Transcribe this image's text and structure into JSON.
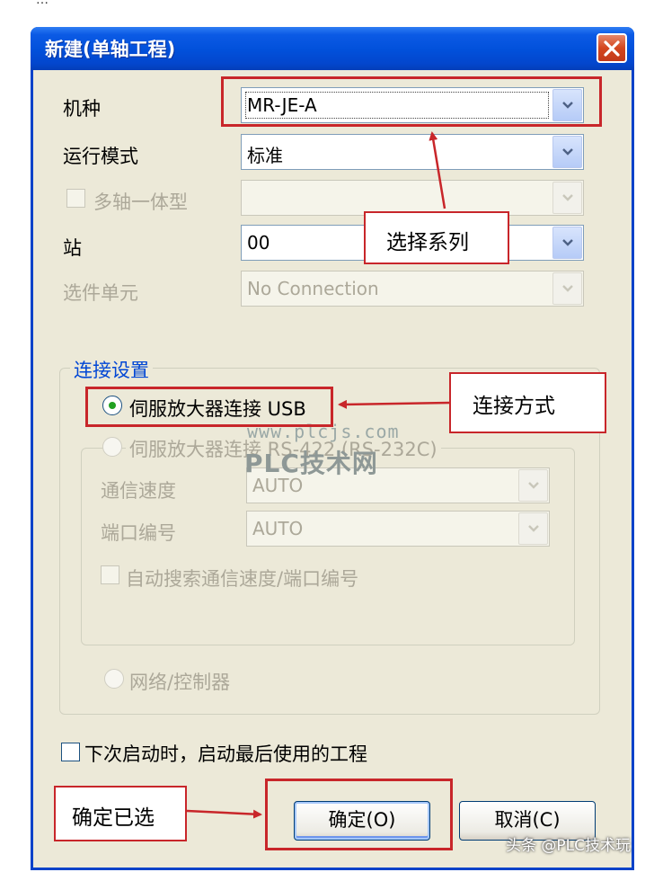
{
  "page_top_fragment": "…",
  "dialog": {
    "title": "新建(单轴工程)"
  },
  "fields": {
    "model_label": "机种",
    "model_value": "MR-JE-A",
    "run_mode_label": "运行模式",
    "run_mode_value": "标准",
    "multi_axis_label": "多轴一体型",
    "station_label": "站",
    "station_value": "00",
    "option_unit_label": "选件单元",
    "option_unit_value": "No Connection"
  },
  "connection": {
    "group_label": "连接设置",
    "usb_label": "伺服放大器连接 USB",
    "rs422_label": "伺服放大器连接 RS-422 (RS-232C)",
    "comm_speed_label": "通信速度",
    "comm_speed_value": "AUTO",
    "port_label": "端口编号",
    "port_value": "AUTO",
    "auto_search_label": "自动搜索通信速度/端口编号",
    "network_label": "网络/控制器"
  },
  "startup_checkbox_label": "下次启动时，启动最后使用的工程",
  "buttons": {
    "ok_label": "确定(O)",
    "cancel_label": "取消(C)"
  },
  "annotations": {
    "select_series": "选择系列",
    "connection_method": "连接方式",
    "confirm_selected": "确定已选"
  },
  "watermarks": {
    "site_url": "www.plcjs.com",
    "site_name": "PLC技术网",
    "footer": "头条 @PLC技术玩"
  },
  "colors": {
    "title_bar": "#0150da",
    "dialog_face": "#ece9d8",
    "annotation_red": "#c8262a",
    "radio_selected": "#21a121"
  }
}
